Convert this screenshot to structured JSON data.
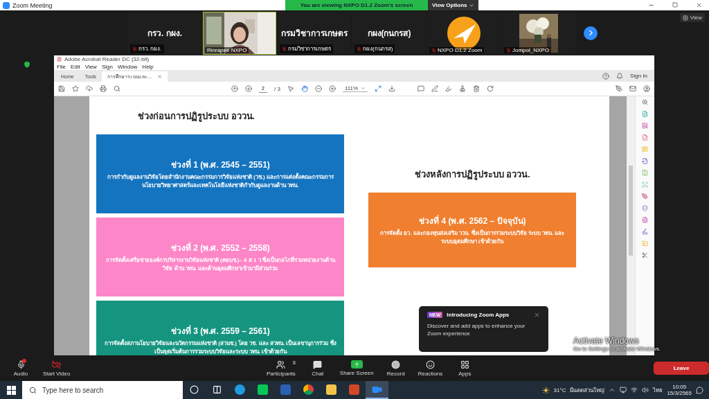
{
  "window": {
    "title": "Zoom Meeting"
  },
  "share_banner": {
    "text": "You are viewing NXPO D1.2 Zoom's screen",
    "button": "View Options"
  },
  "gallery": {
    "tiles": [
      {
        "kind": "text",
        "display": "กรว. กผง.",
        "name": "กรว. กผง.",
        "muted": true,
        "speaking": false
      },
      {
        "kind": "video",
        "name": "Rinrapee NXPO",
        "muted": false,
        "speaking": true
      },
      {
        "kind": "text",
        "display": "กรมวิชาการเกษตร",
        "name": "กรมวิชาการเกษตร",
        "muted": true,
        "speaking": false
      },
      {
        "kind": "text",
        "display": "กผง(กนกรส)",
        "name": "กผง(กนกรส)",
        "muted": true,
        "speaking": false
      },
      {
        "kind": "logo",
        "name": "NXPO D1.2 Zoom",
        "muted": true,
        "speaking": false
      },
      {
        "kind": "video",
        "name": "Jompol_NXPO",
        "muted": true,
        "speaking": false
      }
    ],
    "view": "View"
  },
  "acrobat": {
    "title": "Adobe Acrobat Reader DC (32-bit)",
    "menu": [
      "File",
      "Edit",
      "View",
      "Sign",
      "Window",
      "Help"
    ],
    "tabs": [
      {
        "label": "Home",
        "selected": false
      },
      {
        "label": "Tools",
        "selected": false
      },
      {
        "label": "การศึกษาระบบและ...",
        "selected": true
      }
    ],
    "sign_in": "Sign In",
    "page_value": "2",
    "page_total": "/ 3",
    "zoom": "111%"
  },
  "document": {
    "columns": [
      {
        "heading": "ช่วงก่อนการปฏิรูประบบ อววน.",
        "periods": [
          {
            "title": "ช่วงที่ 1 (พ.ศ. 2545 – 2551)",
            "body": "การกำกับดูแลงานวิจัยโดยสำนักงานคณะกรรมการวิจัยแห่งชาติ (วช.) และการแต่งตั้งคณะกรรมการนโยบายวิทยาศาสตร์และเทคโนโลยีแห่งชาติกำกับดูแลงานด้าน วทน.",
            "color": "#1474bf"
          },
          {
            "title": "ช่วงที่ 2 (พ.ศ. 2552 – 2558)",
            "body": "การจัดตั้งเครือข่ายองค์กรบริหารงานวิจัยแห่งชาติ (คอบช.)– 6 ส 1 ว ซึ่งเป็นกลไกที่รวมหน่วยงานด้านวิจัย ด้าน วทน. และด้านอุดมศึกษาเข้ามามีส่วนร่วม",
            "color": "#fd86c8"
          },
          {
            "title": "ช่วงที่ 3 (พ.ศ. 2559 – 2561)",
            "body": "การจัดตั้งสภานโยบายวิจัยและนวัตกรรมแห่งชาติ (สวนช.) โดย วช. และ สวทน. เป็นเลขานุการร่วม ซึ่งเป็นจุดเริ่มต้นการรวมระบบวิจัยและระบบ วทน. เข้าด้วยกัน",
            "color": "#159580"
          }
        ]
      },
      {
        "heading": "ช่วงหลังการปฏิรูประบบ อววน.",
        "periods": [
          {
            "title": "ช่วงที่ 4 (พ.ศ. 2562 – ปัจจุบัน)",
            "body": "การจัดตั้ง อว. และกองทุนส่งเสริม ววน. ซึ่งเป็นการรวมระบบวิจัย ระบบ วทน. และระบบอุดมศึกษา เข้าด้วยกัน",
            "color": "#f07f2f"
          }
        ]
      }
    ]
  },
  "popup": {
    "badge": "NEW",
    "title": "Introducing Zoom Apps",
    "body": "Discover and add apps to enhance your Zoom experience"
  },
  "activation": {
    "title": "Activate Windows",
    "subtitle": "Go to Settings to activate Windows."
  },
  "meeting_controls": {
    "left": [
      {
        "kind": "audio",
        "label": "Audio"
      },
      {
        "kind": "video",
        "label": "Start Video"
      }
    ],
    "center": [
      {
        "kind": "participants",
        "label": "Participants",
        "count": "8"
      },
      {
        "kind": "chat",
        "label": "Chat"
      },
      {
        "kind": "share",
        "label": "Share Screen"
      },
      {
        "kind": "record",
        "label": "Record"
      },
      {
        "kind": "reactions",
        "label": "Reactions"
      },
      {
        "kind": "apps",
        "label": "Apps"
      }
    ],
    "leave": "Leave"
  },
  "taskbar": {
    "search_placeholder": "Type here to search",
    "apps": [
      {
        "kind": "cortana",
        "active": false
      },
      {
        "kind": "taskview",
        "active": false
      },
      {
        "kind": "edge",
        "active": false
      },
      {
        "kind": "line",
        "active": false
      },
      {
        "kind": "word",
        "active": false
      },
      {
        "kind": "chrome",
        "active": false
      },
      {
        "kind": "files",
        "active": false
      },
      {
        "kind": "powerpoint",
        "active": false
      },
      {
        "kind": "zoom",
        "active": true
      }
    ],
    "temperature": "31°C",
    "weather": "มีแดดส่วนใหญ่",
    "language": "ไทย",
    "time": "10:05",
    "date": "15/3/2565"
  }
}
